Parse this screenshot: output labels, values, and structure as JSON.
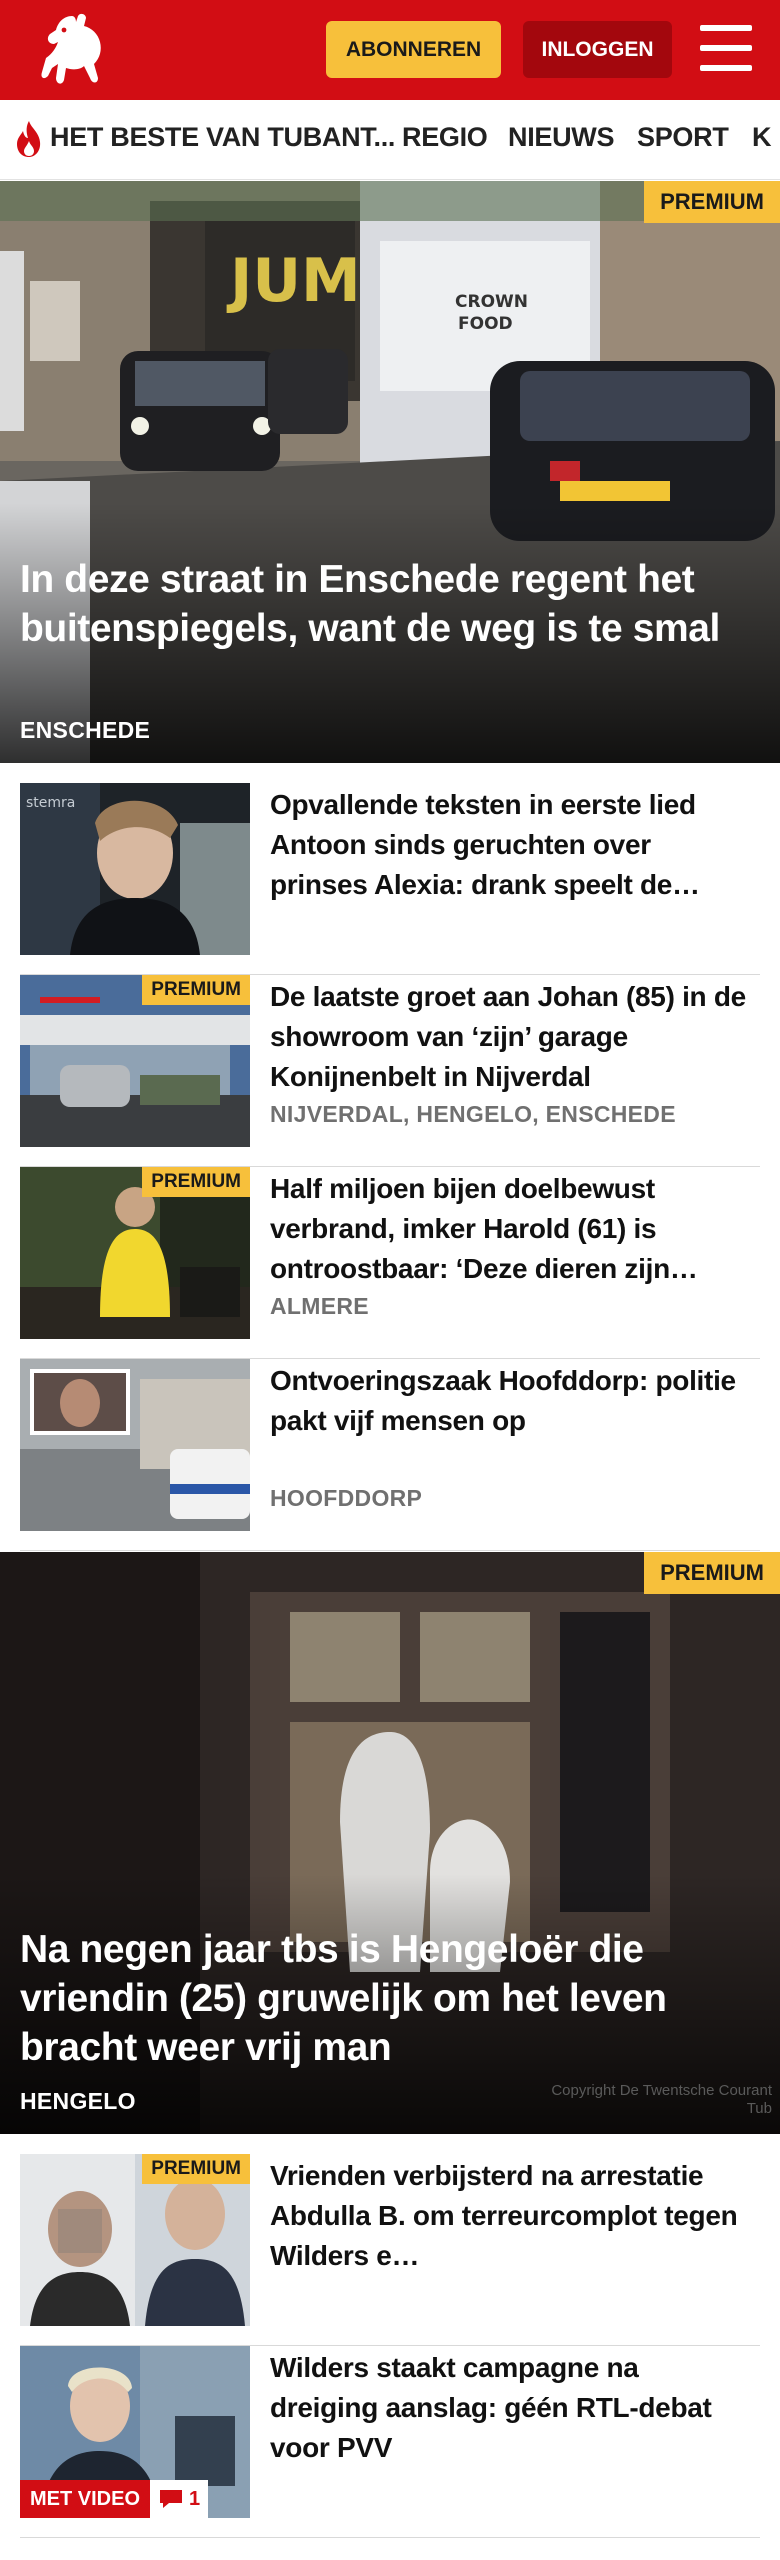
{
  "header": {
    "subscribe_label": "ABONNEREN",
    "login_label": "INLOGGEN"
  },
  "nav": {
    "items": [
      {
        "label": "HET BESTE VAN TUBANT..."
      },
      {
        "label": "REGIO"
      },
      {
        "label": "NIEUWS"
      },
      {
        "label": "SPORT"
      },
      {
        "label": "K"
      }
    ]
  },
  "hero1": {
    "badge": "PREMIUM",
    "title": "In deze straat in Enschede regent het buitenspiegels, want de weg is te smal",
    "tag": "ENSCHEDE"
  },
  "list1": [
    {
      "title": "Opvallende teksten in eerste lied Antoon sinds geruchten over prinses Alexia: drank speelt de…",
      "tag": "",
      "premium": ""
    },
    {
      "title": "De laatste groet aan Johan (85) in de showroom van ‘zijn’ garage Konijnenbelt in Nijverdal",
      "tag": "NIJVERDAL, HENGELO, ENSCHEDE",
      "premium": "PREMIUM"
    },
    {
      "title": "Half miljoen bijen doelbewust verbrand, imker Harold (61) is ontroostbaar: ‘Deze dieren zijn…",
      "tag": "ALMERE",
      "premium": "PREMIUM"
    },
    {
      "title": "Ontvoeringszaak Hoofddorp: politie pakt vijf mensen op",
      "tag": "HOOFDDORP",
      "premium": ""
    }
  ],
  "hero2": {
    "badge": "PREMIUM",
    "title": "Na negen jaar tbs is Hengeloër die vriendin (25) gruwelijk om het leven bracht weer vrij man",
    "tag": "HENGELO",
    "copyright": "Copyright De Twentsche Courant Tub"
  },
  "list2": [
    {
      "title": "Vrienden verbijsterd na arrestatie Abdulla B. om terreurcomplot tegen Wilders e…",
      "premium": "PREMIUM"
    },
    {
      "title": "Wilders staakt campagne na dreiging aanslag: géén RTL-debat voor PVV",
      "video_label": "MET VIDEO",
      "comments": "1"
    }
  ],
  "colors": {
    "brand_red": "#d20d14",
    "premium_yellow": "#f7c03b",
    "login_dark_red": "#a3070d"
  },
  "icons": [
    "tubantia-horse-logo",
    "menu-icon",
    "flame-icon",
    "comment-icon"
  ]
}
